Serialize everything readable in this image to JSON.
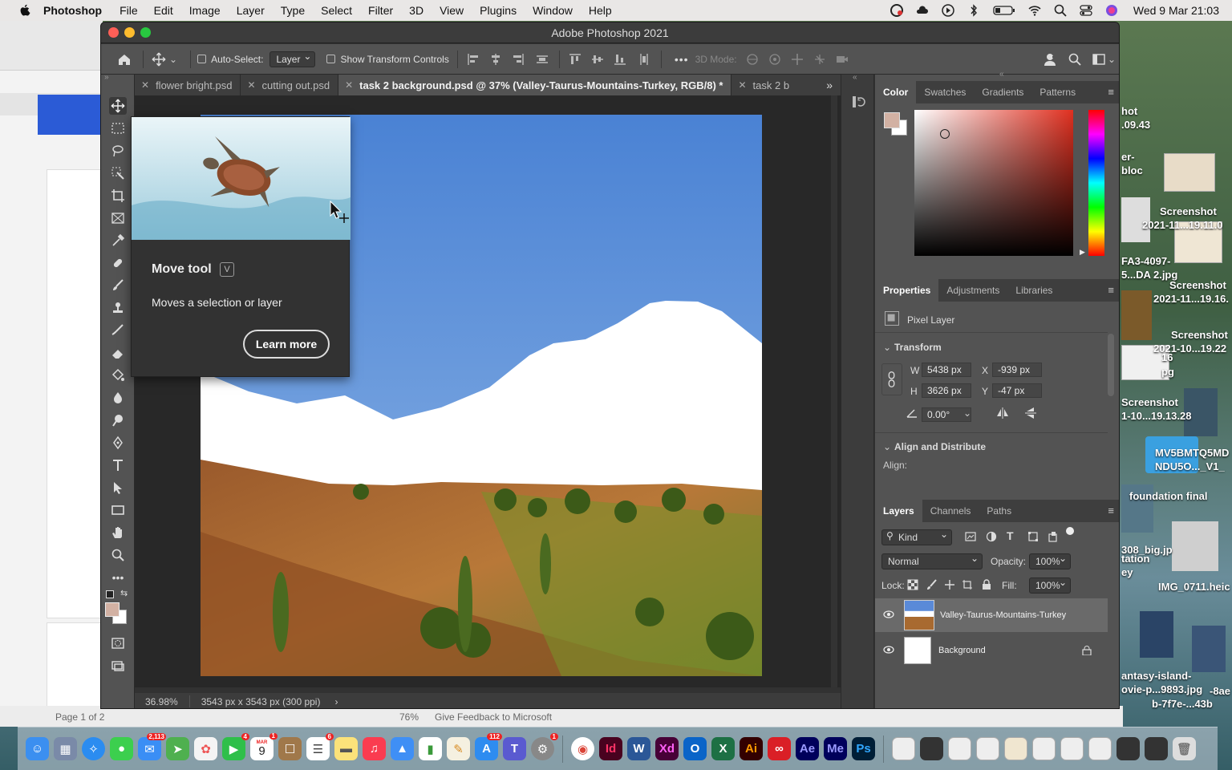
{
  "menubar": {
    "app": "Photoshop",
    "items": [
      "File",
      "Edit",
      "Image",
      "Layer",
      "Type",
      "Select",
      "Filter",
      "3D",
      "View",
      "Plugins",
      "Window",
      "Help"
    ],
    "clock": "Wed 9 Mar  21:03"
  },
  "window": {
    "title": "Adobe Photoshop 2021"
  },
  "options": {
    "auto_select": "Auto-Select:",
    "layer_option": "Layer",
    "show_transform": "Show Transform Controls",
    "mode_3d": "3D Mode:",
    "more": "•••"
  },
  "tabs": [
    {
      "label": "flower bright.psd"
    },
    {
      "label": "cutting out.psd"
    },
    {
      "label": "task 2 background.psd @ 37% (Valley-Taurus-Mountains-Turkey, RGB/8) *"
    },
    {
      "label": "task 2 b"
    }
  ],
  "tooltip": {
    "title": "Move tool",
    "shortcut": "V",
    "description": "Moves a selection or layer",
    "learn_more": "Learn more"
  },
  "status": {
    "zoom": "36.98%",
    "doc_info": "3543 px x 3543 px (300 ppi)"
  },
  "color_panel": {
    "tabs": [
      "Color",
      "Swatches",
      "Gradients",
      "Patterns"
    ],
    "fg_color": "#d2b1a3"
  },
  "properties": {
    "tabs": [
      "Properties",
      "Adjustments",
      "Libraries"
    ],
    "layer_type": "Pixel Layer",
    "transform_label": "Transform",
    "w_label": "W",
    "w": "5438 px",
    "h_label": "H",
    "h": "3626 px",
    "x_label": "X",
    "x": "-939 px",
    "y_label": "Y",
    "y": "-47 px",
    "angle": "0.00°",
    "align_label": "Align and Distribute",
    "align_sub": "Align:"
  },
  "layers": {
    "tabs": [
      "Layers",
      "Channels",
      "Paths"
    ],
    "kind": "Kind",
    "blend": "Normal",
    "opacity_label": "Opacity:",
    "opacity": "100%",
    "lock_label": "Lock:",
    "fill_label": "Fill:",
    "fill": "100%",
    "items": [
      {
        "name": "Valley-Taurus-Mountains-Turkey"
      },
      {
        "name": "Background"
      }
    ]
  },
  "word": {
    "page": "Page 1 of 2",
    "zoom": "76%",
    "feedback": "Give Feedback to Microsoft"
  },
  "desktop_labels": [
    "hot",
    ".09.43",
    "er-",
    "bloc",
    "Screenshot",
    "2021-11...19.11.0",
    "FA3-4097-",
    "5...DA 2.jpg",
    "Screenshot",
    "2021-11...19.16.",
    "Screenshot",
    "2021-10...19.22",
    "16",
    "pg",
    "Screenshot",
    "1-10...19.13.28",
    "MV5BMTQ5MD",
    "NDU5O..._V1_",
    "foundation final",
    "308_big.jp",
    "tation",
    "ey",
    "IMG_0711.heic",
    "antasy-island-",
    "ovie-p...9893.jpg",
    "b-7f7e-...43b",
    "-8ae"
  ],
  "dock": {
    "badges": [
      "2,113",
      "4",
      "1",
      "6",
      "112",
      "1"
    ],
    "calendar_month": "MAR",
    "calendar_day": "9",
    "labels": [
      "Id",
      "Xd",
      "Ai",
      "Ae",
      "Me",
      "Ps"
    ]
  }
}
